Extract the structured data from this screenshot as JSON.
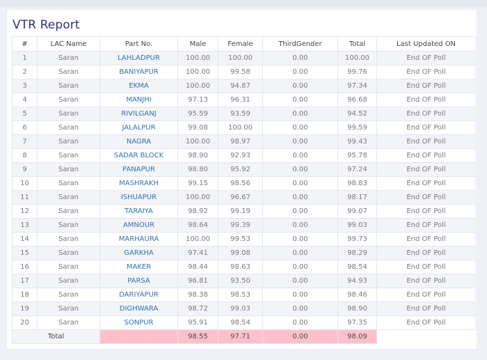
{
  "report": {
    "title": "VTR Report"
  },
  "table": {
    "headers": [
      "#",
      "LAC Name",
      "Part No.",
      "Male",
      "Female",
      "ThirdGender",
      "Total",
      "Last Updated ON"
    ],
    "rows": [
      [
        "1",
        "Saran",
        "LAHLADPUR",
        "100.00",
        "100.00",
        "0.00",
        "100.00",
        "End OF Poll"
      ],
      [
        "2",
        "Saran",
        "BANIYAPUR",
        "100.00",
        "99.58",
        "0.00",
        "99.76",
        "End OF Poll"
      ],
      [
        "3",
        "Saran",
        "EKMA",
        "100.00",
        "94.87",
        "0.00",
        "97.34",
        "End OF Poll"
      ],
      [
        "4",
        "Saran",
        "MANJHI",
        "97.13",
        "96.31",
        "0.00",
        "96.68",
        "End OF Poll"
      ],
      [
        "5",
        "Saran",
        "RIVILGANJ",
        "95.59",
        "93.59",
        "0.00",
        "94.52",
        "End OF Poll"
      ],
      [
        "6",
        "Saran",
        "JALALPUR",
        "99.08",
        "100.00",
        "0.00",
        "99.59",
        "End OF Poll"
      ],
      [
        "7",
        "Saran",
        "NAGRA",
        "100.00",
        "98.97",
        "0.00",
        "99.43",
        "End OF Poll"
      ],
      [
        "8",
        "Saran",
        "SADAR BLOCK",
        "98.90",
        "92.93",
        "0.00",
        "95.78",
        "End OF Poll"
      ],
      [
        "9",
        "Saran",
        "PANAPUR",
        "98.80",
        "95.92",
        "0.00",
        "97.24",
        "End OF Poll"
      ],
      [
        "10",
        "Saran",
        "MASHRAKH",
        "99.15",
        "98.56",
        "0.00",
        "98.83",
        "End OF Poll"
      ],
      [
        "11",
        "Saran",
        "ISHUAPUR",
        "100.00",
        "96.67",
        "0.00",
        "98.17",
        "End OF Poll"
      ],
      [
        "12",
        "Saran",
        "TARAIYA",
        "98.92",
        "99.19",
        "0.00",
        "99.07",
        "End OF Poll"
      ],
      [
        "13",
        "Saran",
        "AMNOUR",
        "98.64",
        "99.39",
        "0.00",
        "99.03",
        "End OF Poll"
      ],
      [
        "14",
        "Saran",
        "MARHAURA",
        "100.00",
        "99.53",
        "0.00",
        "99.73",
        "End OF Poll"
      ],
      [
        "15",
        "Saran",
        "GARKHA",
        "97.41",
        "99.08",
        "0.00",
        "98.29",
        "End OF Poll"
      ],
      [
        "16",
        "Saran",
        "MAKER",
        "98.44",
        "98.63",
        "0.00",
        "98.54",
        "End OF Poll"
      ],
      [
        "17",
        "Saran",
        "PARSA",
        "96.81",
        "93.50",
        "0.00",
        "94.93",
        "End OF Poll"
      ],
      [
        "18",
        "Saran",
        "DARIYAPUR",
        "98.38",
        "98.53",
        "0.00",
        "98.46",
        "End OF Poll"
      ],
      [
        "19",
        "Saran",
        "DIGHWARA",
        "98.72",
        "99.03",
        "0.00",
        "98.90",
        "End OF Poll"
      ],
      [
        "20",
        "Saran",
        "SONPUR",
        "95.91",
        "98.54",
        "0.00",
        "97.35",
        "End OF Poll"
      ]
    ],
    "footer": {
      "label": "Total",
      "male": "98.55",
      "female": "97.71",
      "third": "0.00",
      "total": "98.09"
    }
  },
  "colors": {
    "title": "#2d2f8a",
    "link": "#2f72b7",
    "total_highlight": "#ffc0cb",
    "row_stripe": "#f3f4f8"
  }
}
